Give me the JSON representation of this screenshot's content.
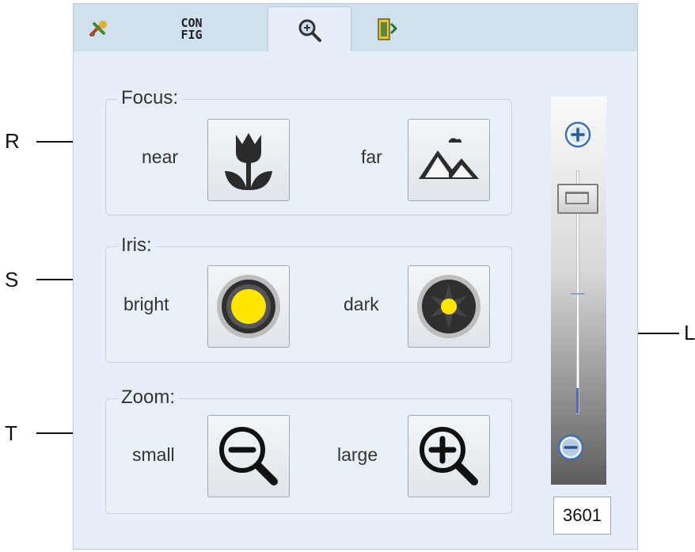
{
  "tabs": [
    {
      "icon": "tools-icon",
      "active": false
    },
    {
      "label": "CON\nFIG",
      "active": false
    },
    {
      "icon": "magnifier-icon",
      "active": true
    },
    {
      "icon": "swap-icon",
      "active": false
    }
  ],
  "focus": {
    "title": "Focus:",
    "near_label": "near",
    "far_label": "far",
    "near_icon": "tulip-icon",
    "far_icon": "mountains-icon"
  },
  "iris": {
    "title": "Iris:",
    "bright_label": "bright",
    "dark_label": "dark",
    "bright_icon": "iris-open-icon",
    "dark_icon": "iris-closed-icon"
  },
  "zoom": {
    "title": "Zoom:",
    "small_label": "small",
    "large_label": "large",
    "small_icon": "zoom-out-icon",
    "large_icon": "zoom-in-icon"
  },
  "slider": {
    "value": "3601",
    "plus_icon": "plus-circle-icon",
    "minus_icon": "minus-circle-icon"
  },
  "callouts": {
    "r": "R",
    "s": "S",
    "t": "T",
    "l": "L"
  },
  "colors": {
    "accent_blue": "#3d6fb4",
    "iris_yellow": "#ffe600",
    "icon_dark": "#2b2b2b"
  }
}
